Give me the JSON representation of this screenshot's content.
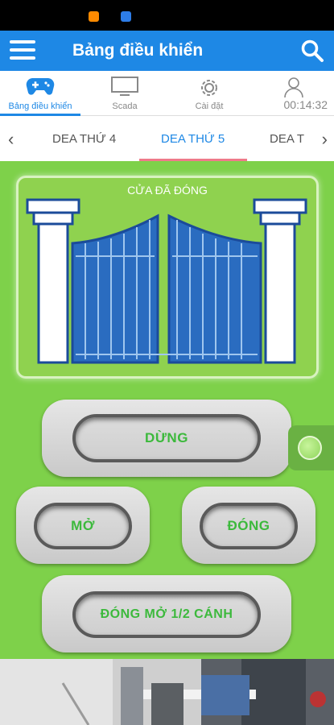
{
  "app": {
    "title": "Bảng điều khiển"
  },
  "tabs": [
    {
      "label": "Bảng điều khiển",
      "icon": "gamepad-icon",
      "active": true
    },
    {
      "label": "Scada",
      "icon": "monitor-icon",
      "active": false
    },
    {
      "label": "Cài đặt",
      "icon": "gear-icon",
      "active": false
    },
    {
      "label": "00:14:32",
      "icon": "user-icon",
      "active": false
    }
  ],
  "device_tabs": [
    {
      "label": "DEA THỨ 4",
      "active": false
    },
    {
      "label": "DEA THỨ 5",
      "active": true
    },
    {
      "label": "DEA T",
      "active": false
    }
  ],
  "gate": {
    "status": "CỬA ĐÃ ĐÓNG"
  },
  "controls": {
    "stop": "DỪNG",
    "open": "MỞ",
    "close": "ĐÓNG",
    "half": "ĐÓNG MỞ 1/2 CÁNH"
  },
  "colors": {
    "primary": "#1e88e5",
    "background": "#7ed14a",
    "button_text": "#3cb93c",
    "active_underline": "#ef7a8a"
  }
}
